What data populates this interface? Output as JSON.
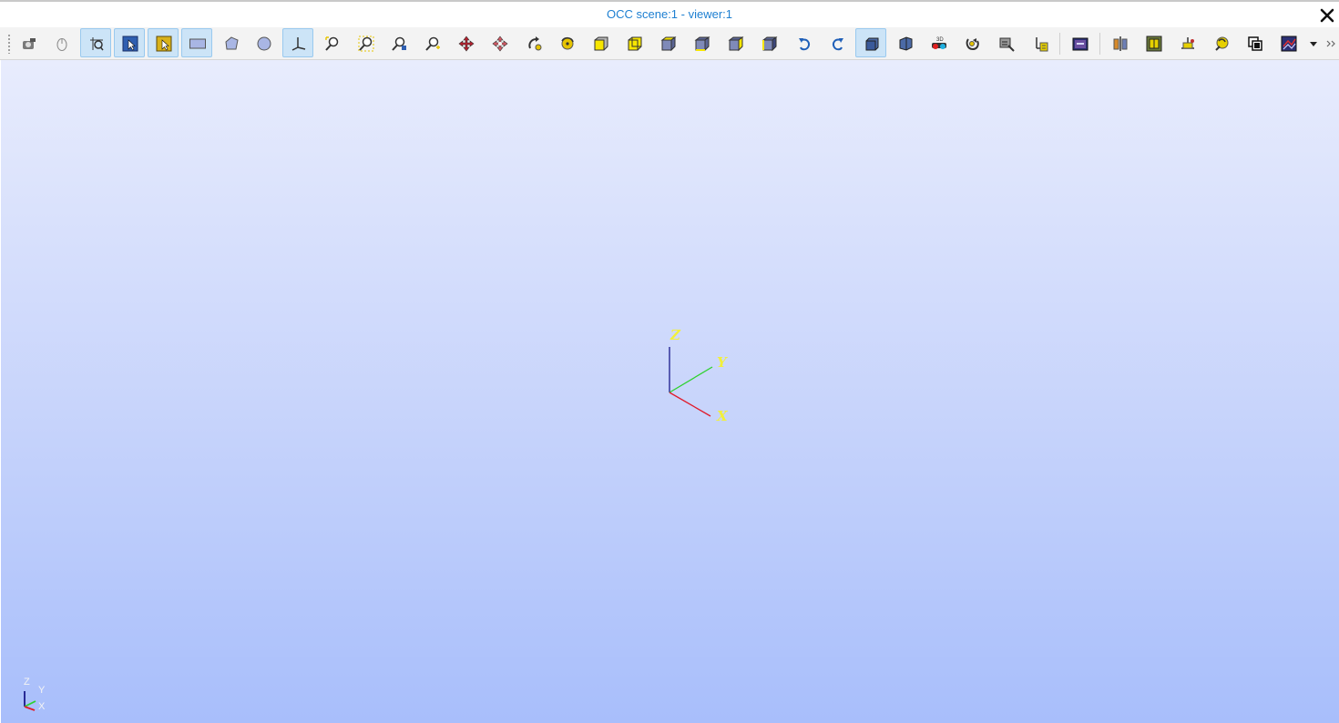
{
  "window": {
    "title": "OCC scene:1 - viewer:1"
  },
  "toolbar": {
    "icons": [
      "fit-all-icon",
      "mouse-icon",
      "select-icon",
      "select-box-icon",
      "select-yellow-icon",
      "rectangle-icon",
      "polygon-icon",
      "circle-icon",
      "axis-icon",
      "zoom-icon",
      "zoom-window-icon",
      "zoom-fit-icon",
      "zoom-selected-icon",
      "pan-icon",
      "global-pan-icon",
      "rotate-icon",
      "rotation-point-icon",
      "view-front-icon",
      "view-back-icon",
      "view-top-icon",
      "view-bottom-icon",
      "view-left-icon",
      "view-right-icon",
      "rotate-ccw-icon",
      "rotate-cw-icon",
      "orthographic-icon",
      "perspective-icon",
      "stereo-3d-icon",
      "reset-view-icon",
      "graduated-axes-icon",
      "trihedron-icon",
      "dump-view-icon",
      "clipping-icon",
      "clipping-planes-icon",
      "scale-icon",
      "illuminate-icon",
      "clone-view-icon",
      "sync-view-icon",
      "dropdown-arrow-icon",
      "more-icon"
    ]
  },
  "trihedron": {
    "x": "X",
    "y": "Y",
    "z": "Z"
  },
  "mini_trihedron": {
    "x": "X",
    "y": "Y",
    "z": "Z"
  },
  "colors": {
    "title": "#1d7fd1",
    "axis_x": "#e01b2b",
    "axis_y": "#2ed12e",
    "axis_z": "#1a1a8c",
    "axis_label": "#f2f03a",
    "background_top": "#e8ecfd",
    "background_bottom": "#a8befb"
  }
}
